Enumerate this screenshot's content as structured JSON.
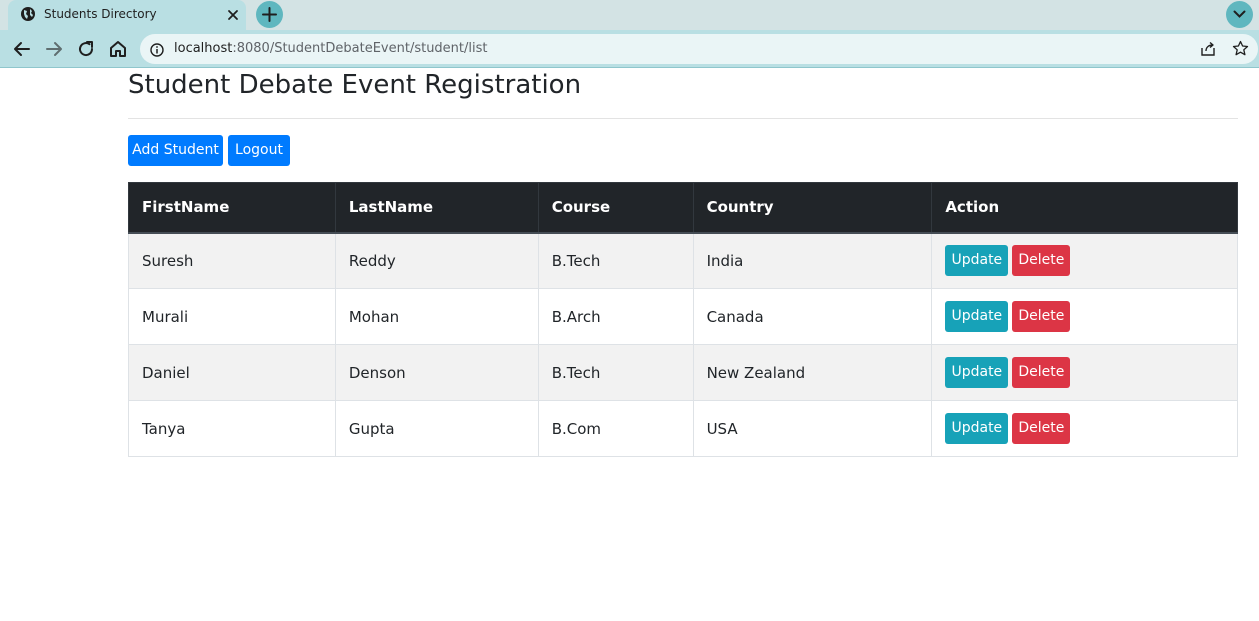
{
  "browser": {
    "tab_title": "Students Directory",
    "url_host": "localhost",
    "url_path": ":8080/StudentDebateEvent/student/list",
    "chrome_color": "#b9dfe3"
  },
  "page": {
    "title": "Student Debate Event Registration",
    "add_student_label": "Add Student",
    "logout_label": "Logout"
  },
  "table": {
    "columns": [
      "FirstName",
      "LastName",
      "Course",
      "Country",
      "Action"
    ],
    "rows": [
      {
        "first_name": "Suresh",
        "last_name": "Reddy",
        "course": "B.Tech",
        "country": "India"
      },
      {
        "first_name": "Murali",
        "last_name": "Mohan",
        "course": "B.Arch",
        "country": "Canada"
      },
      {
        "first_name": "Daniel",
        "last_name": "Denson",
        "course": "B.Tech",
        "country": "New Zealand"
      },
      {
        "first_name": "Tanya",
        "last_name": "Gupta",
        "course": "B.Com",
        "country": "USA"
      }
    ],
    "update_label": "Update",
    "delete_label": "Delete"
  },
  "colors": {
    "primary": "#007bff",
    "info": "#17a2b8",
    "danger": "#dc3545",
    "header_dark": "#212529"
  },
  "icons": [
    "globe-icon",
    "close-icon",
    "plus-icon",
    "chevron-down-icon",
    "back-arrow-icon",
    "forward-arrow-icon",
    "reload-icon",
    "home-icon",
    "info-icon",
    "share-icon",
    "star-icon"
  ]
}
